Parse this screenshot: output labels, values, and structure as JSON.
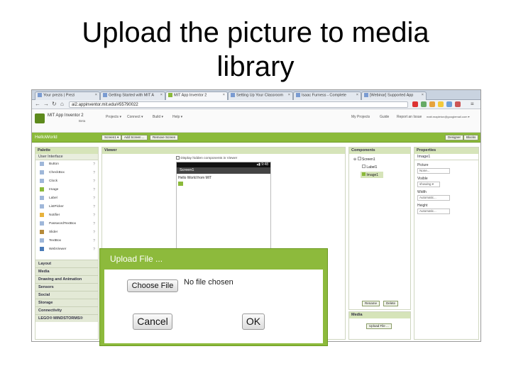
{
  "slide": {
    "title_line1": "Upload the picture to media",
    "title_line2": "library"
  },
  "browser": {
    "tabs": [
      {
        "label": "Your prezis | Prezi"
      },
      {
        "label": "Getting Started with MIT A"
      },
      {
        "label": "MIT App Inventor 2"
      },
      {
        "label": "Setting Up Your Classroom"
      },
      {
        "label": "Isaac Furness - Complete"
      },
      {
        "label": "[Webinar] Supported App"
      }
    ],
    "url": "ai2.appinventor.mit.edu/#55790022"
  },
  "app": {
    "name": "MIT App Inventor 2",
    "beta": "Beta",
    "menu": [
      "Projects ▾",
      "Connect ▾",
      "Build ▾",
      "Help ▾"
    ],
    "right_menu": [
      "My Projects",
      "Guide",
      "Report an Issue",
      "matt.mapleton@googlemail.com ▾"
    ],
    "project": "HelloWorld",
    "toolbar": [
      "Screen1 ▾",
      "Add Screen ...",
      "Remove Screen"
    ],
    "mode_buttons": [
      "Designer",
      "Blocks"
    ]
  },
  "palette": {
    "title": "Palette",
    "section": "User Interface",
    "items": [
      "Button",
      "CheckBox",
      "Clock",
      "Image",
      "Label",
      "ListPicker",
      "Notifier",
      "PasswordTextBox",
      "Slider",
      "TextBox",
      "WebViewer"
    ],
    "categories": [
      "Layout",
      "Media",
      "Drawing and Animation",
      "Sensors",
      "Social",
      "Storage",
      "Connectivity",
      "LEGO® MINDSTORMS®"
    ]
  },
  "viewer": {
    "title": "Viewer",
    "checkbox_label": "Display hidden components in Viewer",
    "status_time": "9:48",
    "screen_title": "Screen1",
    "label_text": "Hello World from MIT"
  },
  "components": {
    "title": "Components",
    "tree": [
      "Screen1",
      "Label1",
      "Image1"
    ],
    "rename": "Rename",
    "delete": "Delete"
  },
  "media": {
    "title": "Media",
    "upload": "Upload File ..."
  },
  "properties": {
    "title": "Properties",
    "component": "Image1",
    "fields": [
      {
        "label": "Picture",
        "value": "None..."
      },
      {
        "label": "Visible",
        "value": "showing ▾"
      },
      {
        "label": "Width",
        "value": "Automatic..."
      },
      {
        "label": "Height",
        "value": "Automatic..."
      }
    ]
  },
  "dialog": {
    "title": "Upload File ...",
    "choose_file": "Choose File",
    "no_file": "No file chosen",
    "cancel": "Cancel",
    "ok": "OK"
  }
}
